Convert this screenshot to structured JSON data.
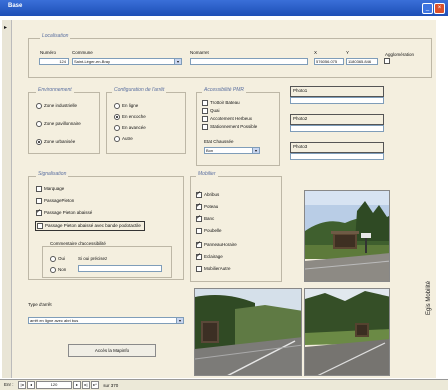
{
  "window": {
    "title": "Base"
  },
  "localisation": {
    "caption": "Localisation",
    "numero_label": "Numéro",
    "numero_value": "124",
    "commune_label": "Commune",
    "commune_value": "Saint-Léger-en-Bray",
    "nomarret_label": "Nomarret",
    "nomarret_value": "",
    "x_label": "X",
    "x_value": "576056.075",
    "y_label": "Y",
    "y_value": "1180365.846",
    "agglo_label": "Agglomération"
  },
  "environnement": {
    "caption": "Environnement",
    "options": [
      "Zone industrielle",
      "Zone pavillonnaire",
      "Zone urbanisée"
    ],
    "selected": 2
  },
  "configuration": {
    "caption": "Configuration de l'arrêt",
    "options": [
      "En ligne",
      "En encoche",
      "En avancée",
      "Autre"
    ],
    "selected": 1
  },
  "accessibilite": {
    "caption": "Accessibilité PMR",
    "items": [
      "Trottoir Bateau",
      "Quai",
      "Accotement Herbeux",
      "Stationnement Possible"
    ],
    "etat_label": "Etat Chaussée",
    "etat_value": "Bon"
  },
  "photos": [
    "Photo1",
    "Photo2",
    "Photo3"
  ],
  "signalisation": {
    "caption": "Signalisation",
    "items": [
      {
        "label": "Marquage",
        "checked": false
      },
      {
        "label": "PassagePieton",
        "checked": false
      },
      {
        "label": "Passage Pieton abaissé",
        "checked": true
      },
      {
        "label": "Passage Pieton abaissé avec bande podotactile",
        "checked": false
      }
    ]
  },
  "commentaire": {
    "caption": "Commentaire d'accessibilité",
    "oui": "Oui",
    "non": "Non",
    "si_oui": "Si oui précisez"
  },
  "mobilier": {
    "caption": "Mobilier",
    "items": [
      {
        "label": "Abribus",
        "checked": true
      },
      {
        "label": "Poteau",
        "checked": true
      },
      {
        "label": "Banc",
        "checked": true
      },
      {
        "label": "Poubelle",
        "checked": false
      },
      {
        "label": "PanneauHoraire",
        "checked": true
      },
      {
        "label": "Eclairage",
        "checked": true
      },
      {
        "label": "MobilierAutre",
        "checked": false
      }
    ]
  },
  "type_arret": {
    "label": "Type d'arrêt",
    "value": "arrêt en ligne avec abri bus"
  },
  "access_button": "Accès la Mapinfo",
  "statusbar": {
    "label": "Enr :",
    "current": "120",
    "total": "sur 370"
  },
  "credit": "Egis Mobilité"
}
